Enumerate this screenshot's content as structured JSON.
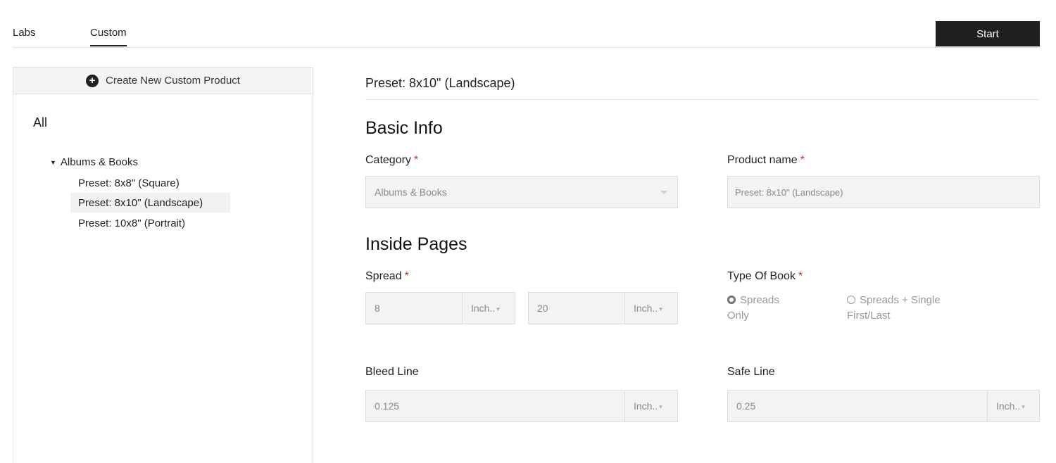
{
  "tabs": [
    {
      "label": "Labs"
    },
    {
      "label": "Custom"
    }
  ],
  "start_label": "Start",
  "sidebar": {
    "create_label": "Create New Custom Product",
    "all_label": "All",
    "group_label": "Albums & Books",
    "items": [
      {
        "label": "Preset: 8x8\" (Square)"
      },
      {
        "label": "Preset: 8x10\" (Landscape)"
      },
      {
        "label": "Preset: 10x8\" (Portrait)"
      }
    ]
  },
  "main": {
    "preset_title": "Preset: 8x10\" (Landscape)",
    "basic_info_title": "Basic Info",
    "category_label": "Category",
    "category_value": "Albums & Books",
    "product_name_label": "Product name",
    "product_name_value": "Preset: 8x10\" (Landscape)",
    "inside_pages_title": "Inside Pages",
    "spread_label": "Spread",
    "spread_width": "8",
    "spread_width_unit": "Inch..",
    "spread_height": "20",
    "spread_height_unit": "Inch..",
    "type_of_book_label": "Type Of Book",
    "radio_option_1_line1": "Spreads",
    "radio_option_1_line2": "Only",
    "radio_option_2_line1": "Spreads + Single",
    "radio_option_2_line2": "First/Last",
    "bleed_label": "Bleed Line",
    "bleed_value": "0.125",
    "bleed_unit": "Inch..",
    "safe_label": "Safe Line",
    "safe_value": "0.25",
    "safe_unit": "Inch..",
    "required_mark": "*"
  }
}
